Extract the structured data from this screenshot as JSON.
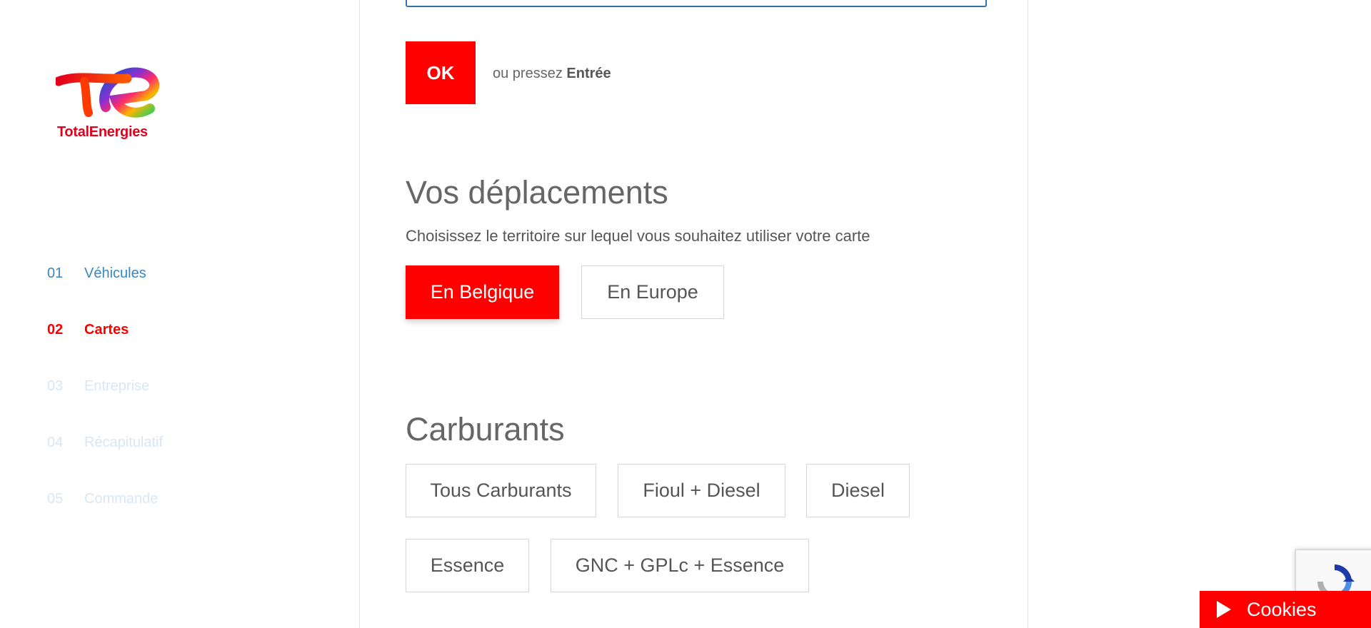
{
  "brand": {
    "name": "TotalEnergies"
  },
  "steps": [
    {
      "num": "01",
      "label": "Véhicules",
      "state": "done"
    },
    {
      "num": "02",
      "label": "Cartes",
      "state": "active"
    },
    {
      "num": "03",
      "label": "Entreprise",
      "state": "pending"
    },
    {
      "num": "04",
      "label": "Récapitulatif",
      "state": "pending"
    },
    {
      "num": "05",
      "label": "Commande",
      "state": "pending"
    }
  ],
  "confirm": {
    "ok_label": "OK",
    "hint_prefix": "ou pressez",
    "hint_key": "Entrée"
  },
  "travel": {
    "title": "Vos déplacements",
    "subtitle": "Choisissez le territoire sur lequel vous souhaitez utiliser votre carte",
    "options": [
      {
        "label": "En Belgique",
        "selected": true
      },
      {
        "label": "En Europe",
        "selected": false
      }
    ]
  },
  "fuels": {
    "title": "Carburants",
    "options": [
      {
        "label": "Tous Carburants",
        "selected": false
      },
      {
        "label": "Fioul + Diesel",
        "selected": false
      },
      {
        "label": "Diesel",
        "selected": false
      },
      {
        "label": "Essence",
        "selected": false
      },
      {
        "label": "GNC + GPLc + Essence",
        "selected": false
      }
    ]
  },
  "cookies": {
    "label": "Cookies"
  },
  "colors": {
    "accent": "#ff0000",
    "step_done": "#3a86c1",
    "step_pending": "#d7e7f5",
    "text": "#666666"
  },
  "icons": {
    "recaptcha": "recaptcha-icon",
    "play": "play-icon"
  }
}
